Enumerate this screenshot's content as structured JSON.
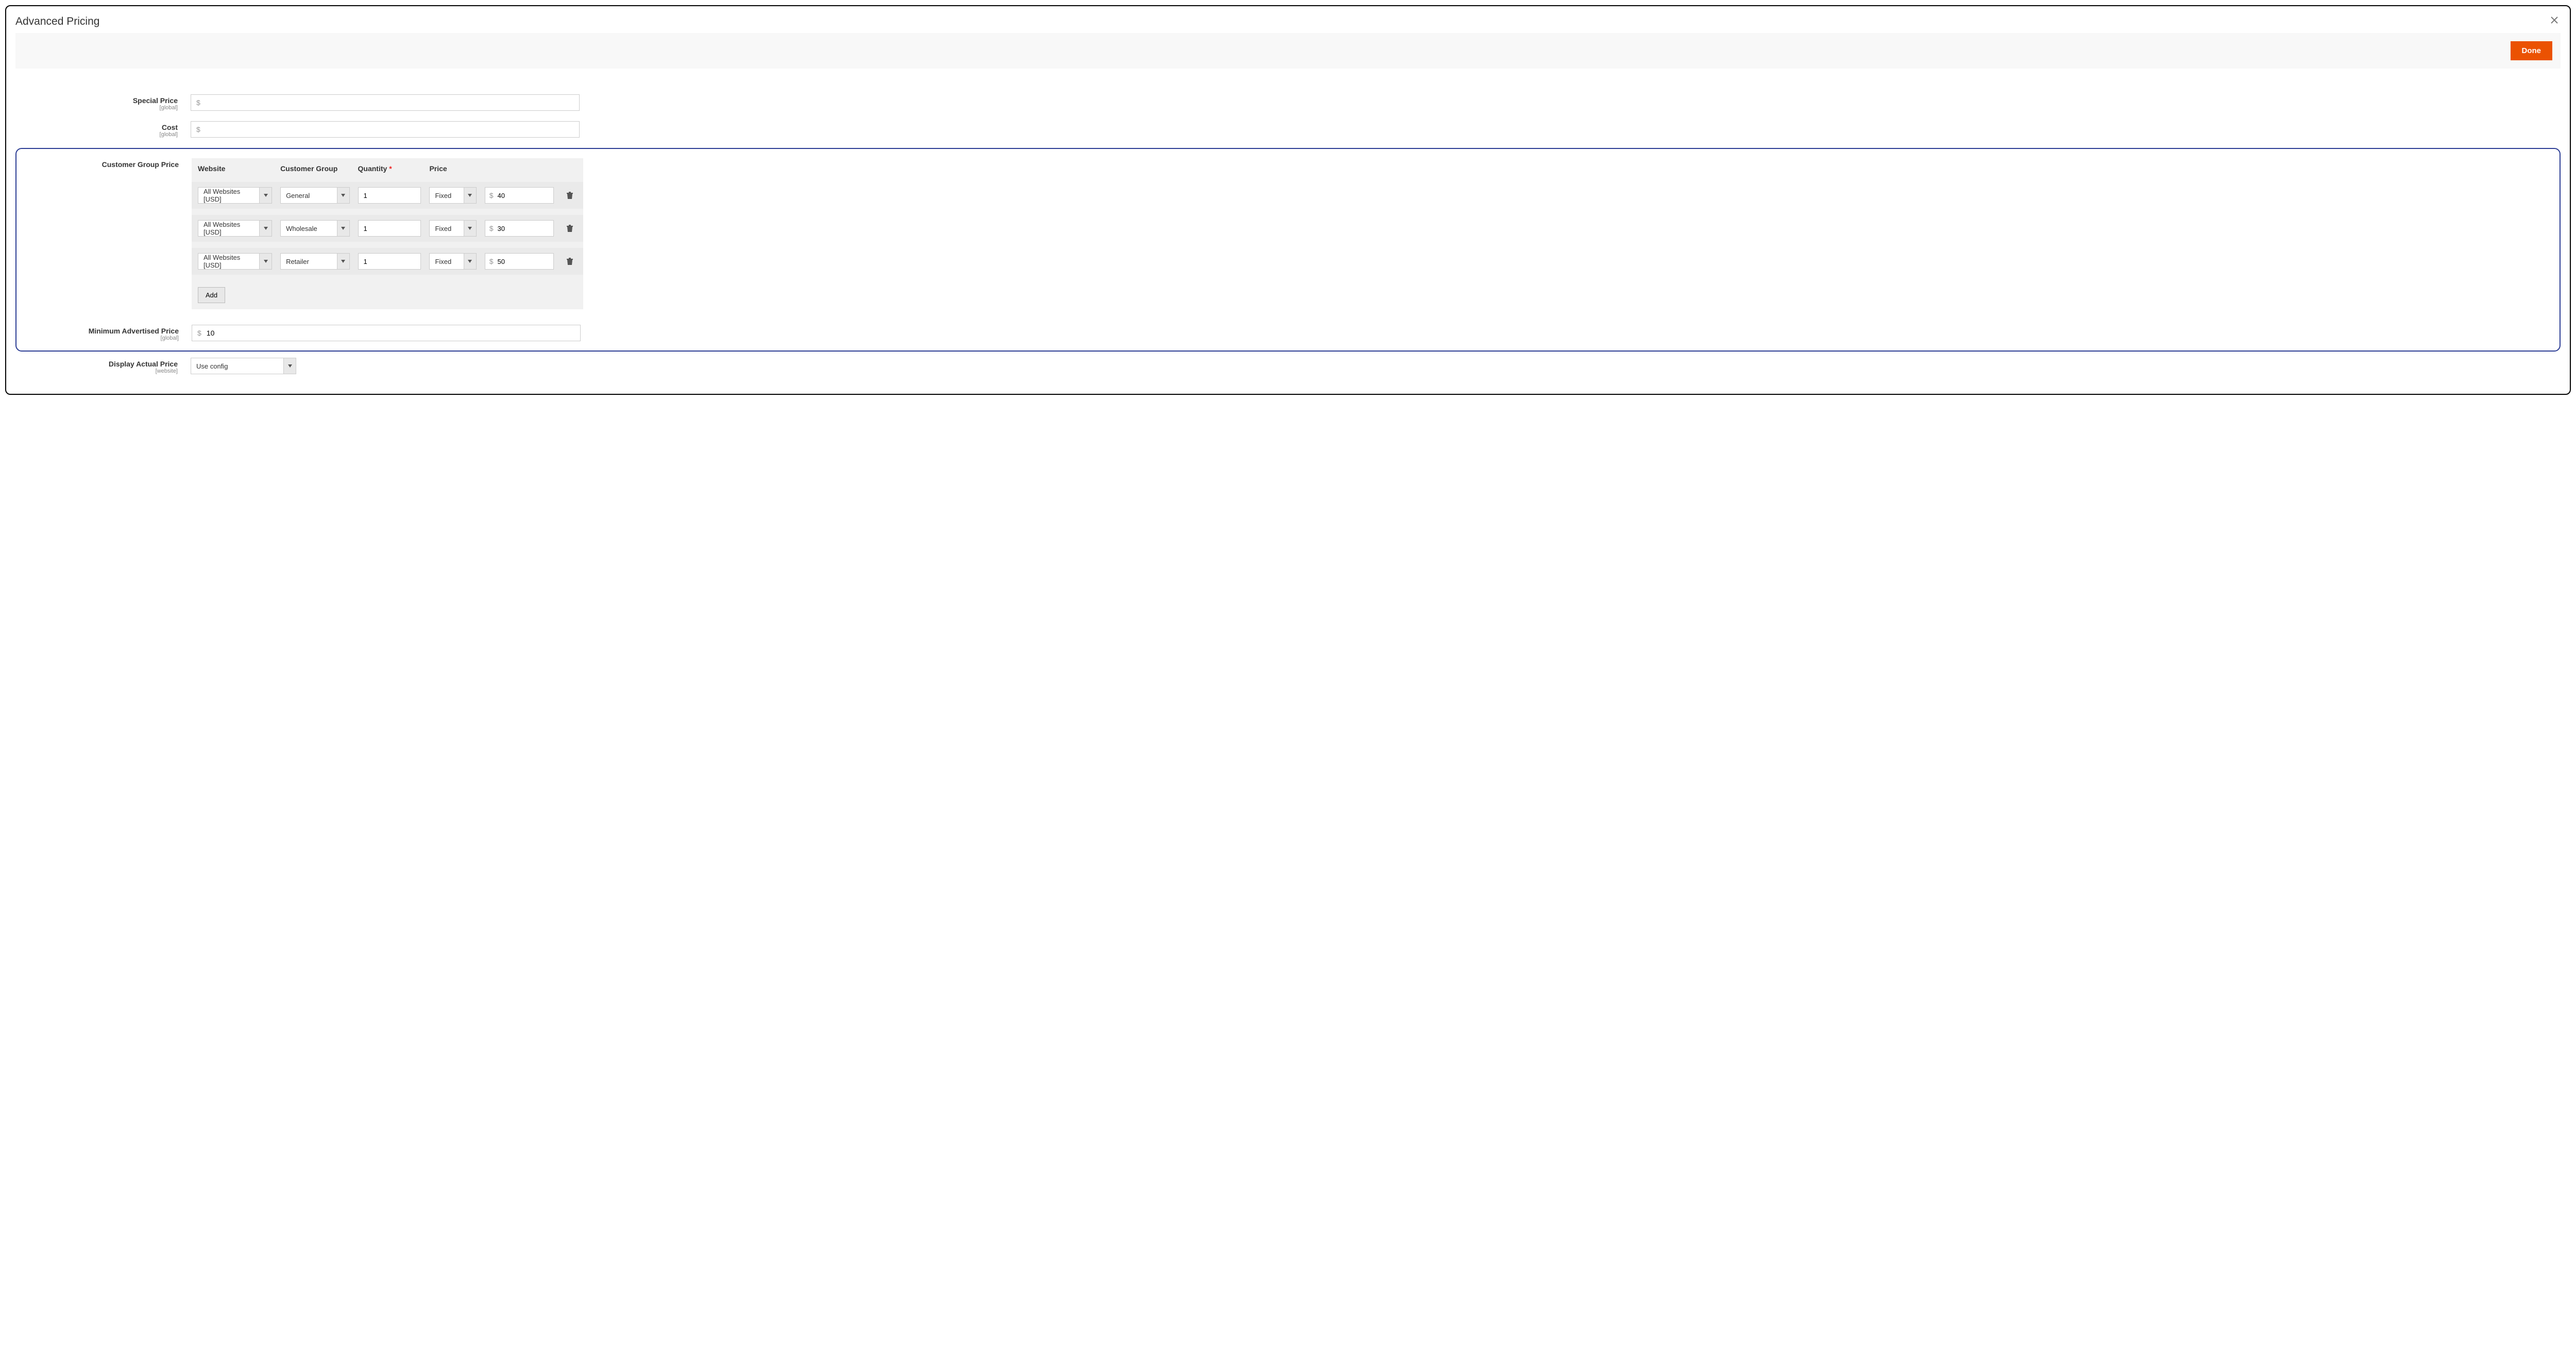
{
  "modal": {
    "title": "Advanced Pricing",
    "done_label": "Done"
  },
  "labels": {
    "special_price": "Special Price",
    "cost": "Cost",
    "customer_group_price": "Customer Group Price",
    "min_advertised_price": "Minimum Advertised Price",
    "display_actual_price": "Display Actual Price",
    "scope_global": "[global]",
    "scope_website": "[website]"
  },
  "currency_symbol": "$",
  "special_price_value": "",
  "cost_value": "",
  "min_advertised_price_value": "10",
  "display_actual_price_value": "Use config",
  "group_price": {
    "headers": {
      "website": "Website",
      "customer_group": "Customer Group",
      "quantity": "Quantity",
      "price": "Price"
    },
    "add_label": "Add",
    "rows": [
      {
        "website": "All Websites [USD]",
        "group": "General",
        "quantity": "1",
        "price_type": "Fixed",
        "price": "40"
      },
      {
        "website": "All Websites [USD]",
        "group": "Wholesale",
        "quantity": "1",
        "price_type": "Fixed",
        "price": "30"
      },
      {
        "website": "All Websites [USD]",
        "group": "Retailer",
        "quantity": "1",
        "price_type": "Fixed",
        "price": "50"
      }
    ]
  }
}
